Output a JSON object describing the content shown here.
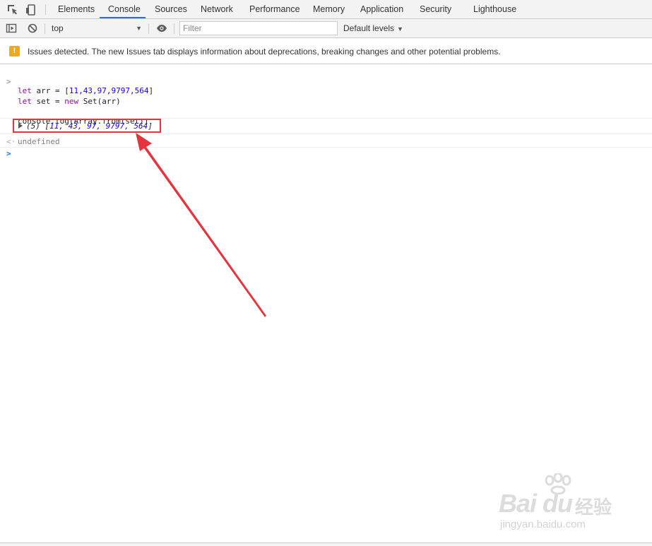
{
  "tabs": [
    {
      "label": "Elements"
    },
    {
      "label": "Console"
    },
    {
      "label": "Sources"
    },
    {
      "label": "Network"
    },
    {
      "label": "Performance"
    },
    {
      "label": "Memory"
    },
    {
      "label": "Application"
    },
    {
      "label": "Security"
    },
    {
      "label": "Lighthouse"
    }
  ],
  "active_tab": "Console",
  "toolbar": {
    "context": "top",
    "filter_placeholder": "Filter",
    "levels": "Default levels"
  },
  "issues": {
    "message": "Issues detected. The new Issues tab displays information about deprecations, breaking changes and other potential problems."
  },
  "console": {
    "line1": {
      "kw": "let",
      "name": " arr = [",
      "nums": "11,43,97,9797,564",
      "close": "]"
    },
    "line2": {
      "kw1": "let",
      "name": " set = ",
      "kw2": "new",
      "rest": " Set(arr)"
    },
    "line3": "console.log(Array.from(set))",
    "result": {
      "count": "(5) ",
      "open": "[",
      "values": "11, 43, 97, 9797, 564",
      "close": "]"
    },
    "return_value": "undefined"
  },
  "watermark": {
    "brand": "Bai du",
    "cn": "经验",
    "url": "jingyan.baidu.com"
  },
  "colors": {
    "accent": "#1a73e8",
    "highlight": "#e5343d",
    "warning": "#f1a81b",
    "keyword": "#881391",
    "number": "#1c00cf"
  }
}
